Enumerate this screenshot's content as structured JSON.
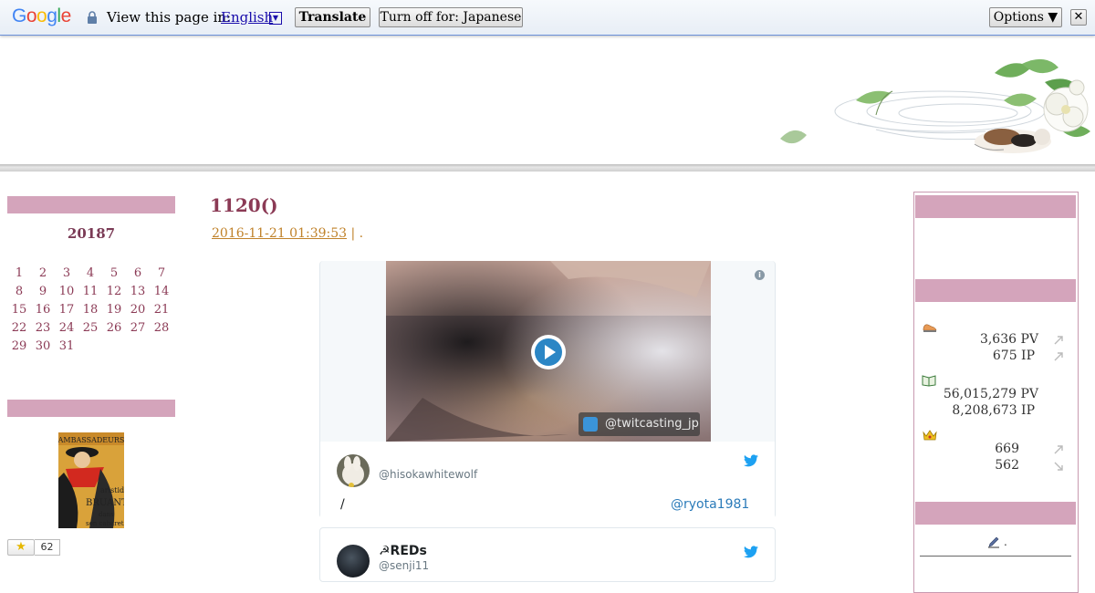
{
  "translate_bar": {
    "logo": "Google",
    "logo_colors": [
      "#4285f4",
      "#ea4335",
      "#fbbc05",
      "#4285f4",
      "#34a853",
      "#ea4335"
    ],
    "view_text": "View this page in:",
    "language": "English",
    "dropdown_arrow": "▼",
    "translate_button": "Translate",
    "turn_off_button": "Turn off for: Japanese",
    "options_button": "Options ▼",
    "close_button": "✕"
  },
  "left_sidebar": {
    "calendar_title": "20187",
    "calendar_days": [
      [
        "1",
        "2",
        "3",
        "4",
        "5",
        "6",
        "7"
      ],
      [
        "8",
        "9",
        "10",
        "11",
        "12",
        "13",
        "14"
      ],
      [
        "15",
        "16",
        "17",
        "18",
        "19",
        "20",
        "21"
      ],
      [
        "22",
        "23",
        "24",
        "25",
        "26",
        "27",
        "28"
      ],
      [
        "29",
        "30",
        "31"
      ]
    ],
    "star_icon": "star-icon",
    "star_count": "62"
  },
  "post": {
    "title": "1120()",
    "date": "2016-11-21 01:39:53",
    "meta_suffix": " | ."
  },
  "tweet_embed": {
    "stream_tag": "@twitcasting_jp",
    "author_handle": "@hisokawhitewolf",
    "text": "/",
    "mention": "@ryota1981"
  },
  "tweet_embed_2": {
    "author_name": "☭REDs",
    "author_handle": "@senji11"
  },
  "right_sidebar": {
    "today_pv": "3,636 PV",
    "today_ip": "675 IP",
    "total_pv": "56,015,279 PV",
    "total_ip": "8,208,673 IP",
    "rank_1": "669",
    "rank_2": "562",
    "footer_mark": "."
  },
  "colors": {
    "accent_pink": "#d4a4bb",
    "title_color": "#8b3a55",
    "date_color": "#c0822a",
    "twitter_blue": "#1da1f2"
  }
}
